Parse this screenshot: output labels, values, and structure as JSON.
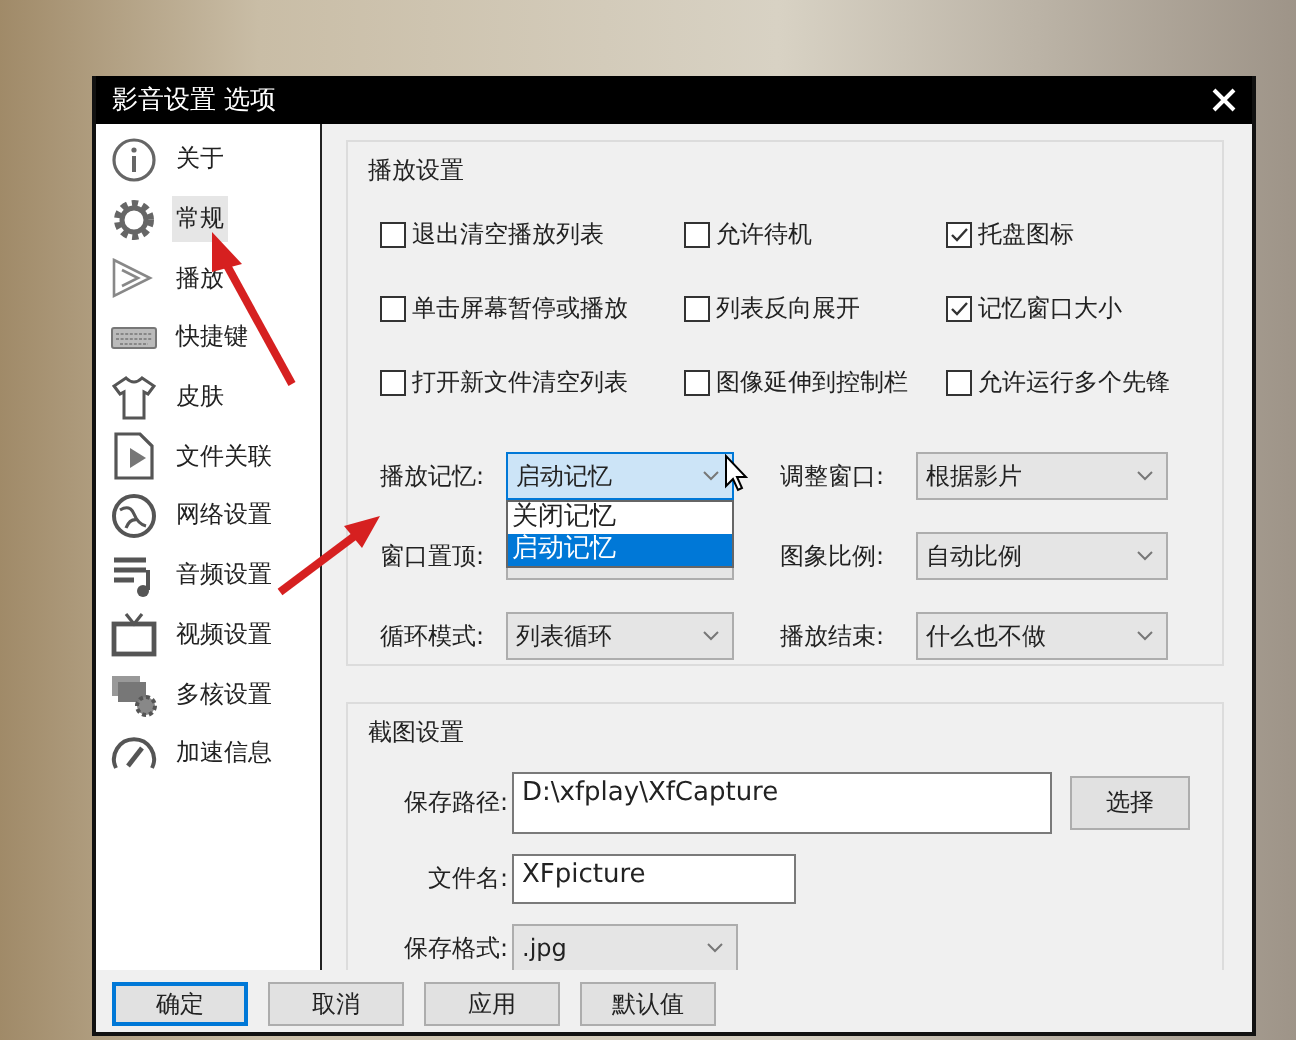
{
  "window": {
    "title": "影音设置 选项"
  },
  "sidebar": {
    "items": [
      {
        "label": "关于",
        "selected": false
      },
      {
        "label": "常规",
        "selected": true
      },
      {
        "label": "播放",
        "selected": false
      },
      {
        "label": "快捷键",
        "selected": false
      },
      {
        "label": "皮肤",
        "selected": false
      },
      {
        "label": "文件关联",
        "selected": false
      },
      {
        "label": "网络设置",
        "selected": false
      },
      {
        "label": "音频设置",
        "selected": false
      },
      {
        "label": "视频设置",
        "selected": false
      },
      {
        "label": "多核设置",
        "selected": false
      },
      {
        "label": "加速信息",
        "selected": false
      }
    ]
  },
  "playback": {
    "title": "播放设置",
    "checkboxes": [
      {
        "label": "退出清空播放列表",
        "checked": false
      },
      {
        "label": "允许待机",
        "checked": false
      },
      {
        "label": "托盘图标",
        "checked": true
      },
      {
        "label": "单击屏幕暂停或播放",
        "checked": false
      },
      {
        "label": "列表反向展开",
        "checked": false
      },
      {
        "label": "记忆窗口大小",
        "checked": true
      },
      {
        "label": "打开新文件清空列表",
        "checked": false
      },
      {
        "label": "图像延伸到控制栏",
        "checked": false
      },
      {
        "label": "允许运行多个先锋",
        "checked": false
      }
    ],
    "combos": [
      {
        "label": "播放记忆:",
        "value": "启动记忆",
        "expanded": true,
        "options": [
          {
            "label": "关闭记忆",
            "selected": false
          },
          {
            "label": "启动记忆",
            "selected": true
          }
        ]
      },
      {
        "label": "调整窗口:",
        "value": "根据影片",
        "expanded": false
      },
      {
        "label": "窗口置顶:",
        "expanded": false
      },
      {
        "label": "图象比例:",
        "value": "自动比例",
        "expanded": false
      },
      {
        "label": "循环模式:",
        "value": "列表循环",
        "expanded": false
      },
      {
        "label": "播放结束:",
        "value": "什么也不做",
        "expanded": false
      }
    ]
  },
  "capture": {
    "title": "截图设置",
    "path": {
      "label": "保存路径:",
      "value": "D:\\xfplay\\XfCapture"
    },
    "choose_button": "选择",
    "filename": {
      "label": "文件名:",
      "value": "XFpicture"
    },
    "format": {
      "label": "保存格式:",
      "value": ".jpg"
    }
  },
  "buttons": [
    {
      "label": "确定",
      "default": true
    },
    {
      "label": "取消",
      "default": false
    },
    {
      "label": "应用",
      "default": false
    },
    {
      "label": "默认值",
      "default": false
    }
  ]
}
